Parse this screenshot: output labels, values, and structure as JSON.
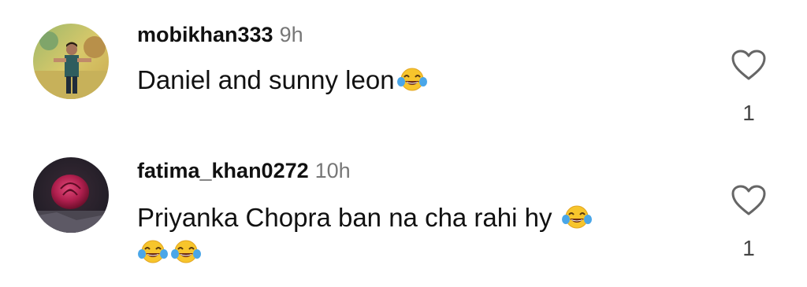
{
  "comments": [
    {
      "username": "mobikhan333",
      "time": "9h",
      "text": "Daniel and sunny leon",
      "emoji_after_text": [
        "face-with-tears-of-joy"
      ],
      "emoji_line2": [],
      "like_count": "1",
      "avatar": "man-standing-photo"
    },
    {
      "username": "fatima_khan0272",
      "time": "10h",
      "text": "Priyanka Chopra ban na cha rahi hy",
      "emoji_after_text": [
        "face-with-tears-of-joy"
      ],
      "emoji_line2": [
        "face-with-tears-of-joy",
        "face-with-tears-of-joy"
      ],
      "like_count": "1",
      "avatar": "red-rose-photo"
    }
  ],
  "icons": {
    "like": "heart-outline-icon"
  },
  "colors": {
    "username": "#111111",
    "timestamp": "#777777",
    "count": "#444444"
  }
}
